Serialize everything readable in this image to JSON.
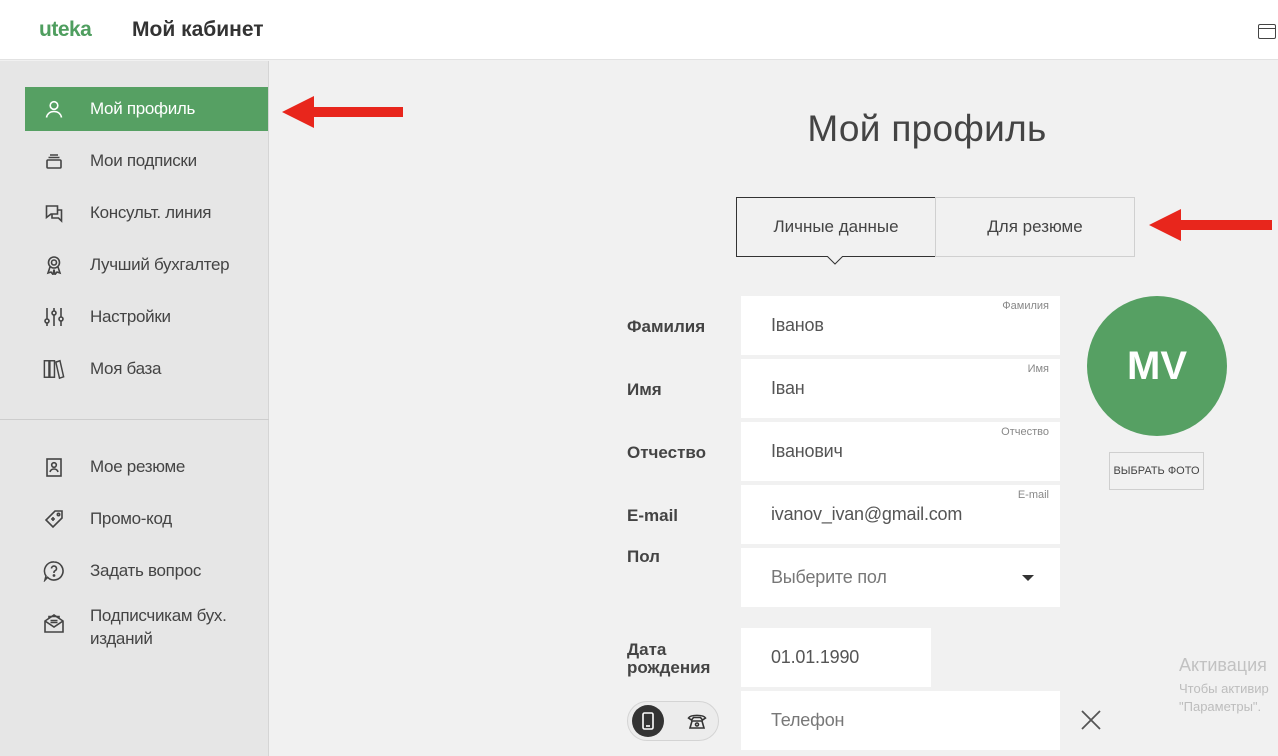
{
  "header": {
    "logo": "uteka",
    "title": "Мой кабинет"
  },
  "sidebar": {
    "items": [
      {
        "label": "Мой профиль",
        "icon": "user-icon",
        "active": true
      },
      {
        "label": "Мои подписки",
        "icon": "subscriptions-icon"
      },
      {
        "label": "Консульт. линия",
        "icon": "chat-icon"
      },
      {
        "label": "Лучший бухгалтер",
        "icon": "award-icon"
      },
      {
        "label": "Настройки",
        "icon": "sliders-icon"
      },
      {
        "label": "Моя база",
        "icon": "books-icon"
      }
    ],
    "secondary": [
      {
        "label": "Мое резюме",
        "icon": "resume-icon"
      },
      {
        "label": "Промо-код",
        "icon": "tag-icon"
      },
      {
        "label": "Задать вопрос",
        "icon": "question-icon"
      },
      {
        "label": "Подписчикам бух. изданий",
        "icon": "mail-icon"
      }
    ]
  },
  "main": {
    "title": "Мой профиль",
    "tabs": [
      {
        "label": "Личные данные",
        "active": true
      },
      {
        "label": "Для резюме",
        "active": false
      }
    ],
    "form": {
      "surname": {
        "label": "Фамилия",
        "value": "Іванов",
        "caption": "Фамилия"
      },
      "name": {
        "label": "Имя",
        "value": "Іван",
        "caption": "Имя"
      },
      "patronymic": {
        "label": "Отчество",
        "value": "Іванович",
        "caption": "Отчество"
      },
      "email": {
        "label": "E-mail",
        "value": "ivanov_ivan@gmail.com",
        "caption": "E-mail"
      },
      "gender": {
        "label": "Пол",
        "placeholder": "Выберите пол"
      },
      "birthdate": {
        "label": "Дата рождения",
        "value": "01.01.1990"
      },
      "phone": {
        "placeholder": "Телефон"
      }
    },
    "avatar": {
      "initials": "MV",
      "button_label": "ВЫБРАТЬ ФОТО"
    }
  },
  "activation_notice": {
    "title": "Активация",
    "line1": "Чтобы активир",
    "line2": "\"Параметры\"."
  },
  "colors": {
    "brand": "#56a063",
    "active_item_bg": "#56a063",
    "annotation_arrow": "#e8261c"
  }
}
